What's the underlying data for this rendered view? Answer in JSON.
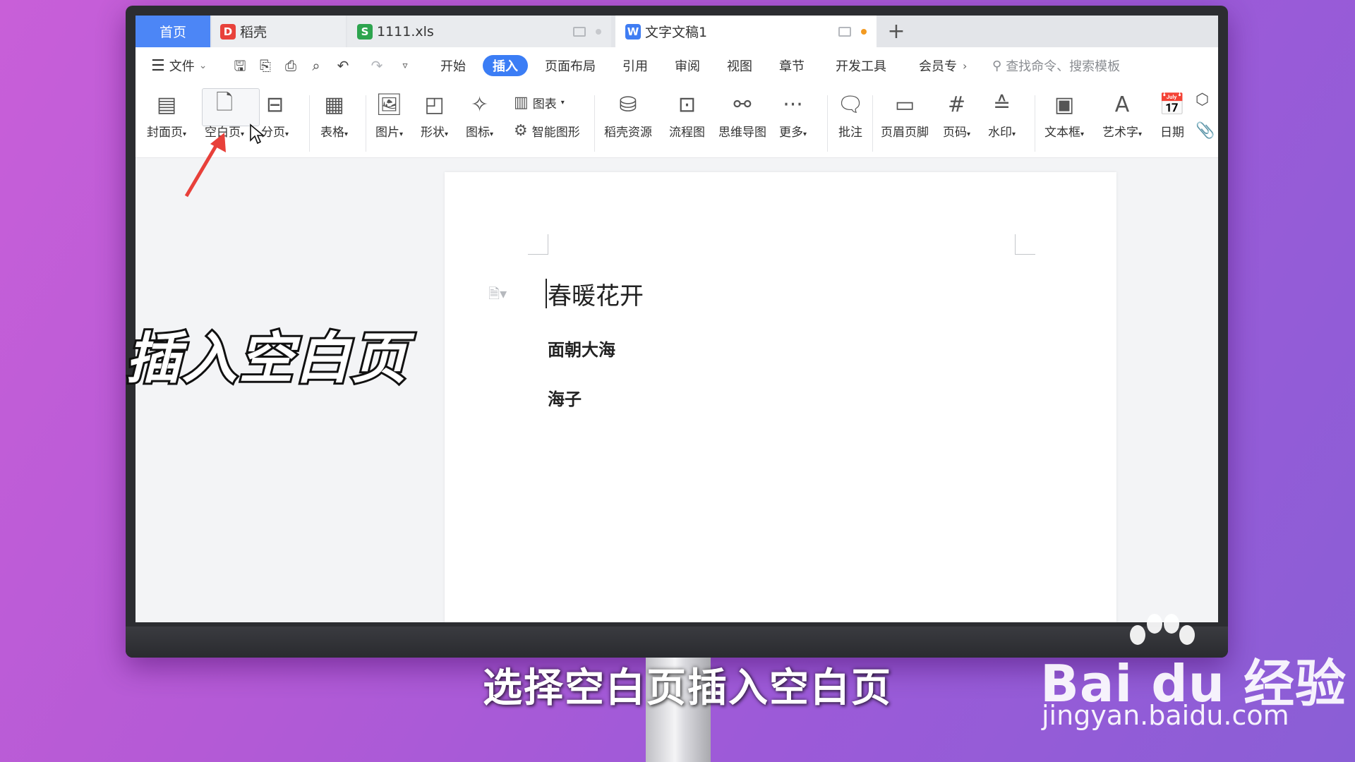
{
  "tabs": {
    "home": "首页",
    "daoke": "稻壳",
    "xls": "1111.xls",
    "doc": "文字文稿1",
    "add": "+"
  },
  "menubar": {
    "file": "文件",
    "tabs": [
      "开始",
      "插入",
      "页面布局",
      "引用",
      "审阅",
      "视图",
      "章节",
      "开发工具",
      "会员专"
    ],
    "active": "插入",
    "more": "›",
    "search": "查找命令、搜索模板"
  },
  "ribbon": {
    "cover": "封面页",
    "blank": "空白页",
    "pagebreak": "分页",
    "table": "表格",
    "picture": "图片",
    "shape": "形状",
    "icon": "图标",
    "chart": "图表",
    "smartart": "智能图形",
    "daoke_res": "稻壳资源",
    "flowchart": "流程图",
    "mindmap": "思维导图",
    "more": "更多",
    "comment": "批注",
    "header_footer": "页眉页脚",
    "page_num": "页码",
    "watermark": "水印",
    "textbox": "文本框",
    "wordart": "艺术字",
    "date": "日期",
    "dropdown": "▾"
  },
  "document": {
    "title": "春暖花开",
    "line1": "面朝大海",
    "line2": "海子"
  },
  "overlay": {
    "title": "插入空白页",
    "caption": "选择空白页插入空白页",
    "watermark_brand": "Bai du 经验",
    "watermark_url": "jingyan.baidu.com"
  },
  "colors": {
    "accent": "#3b7df5",
    "home_tab": "#4c86f6",
    "unsaved_dot": "#f29a21",
    "arrow": "#e8403a"
  }
}
